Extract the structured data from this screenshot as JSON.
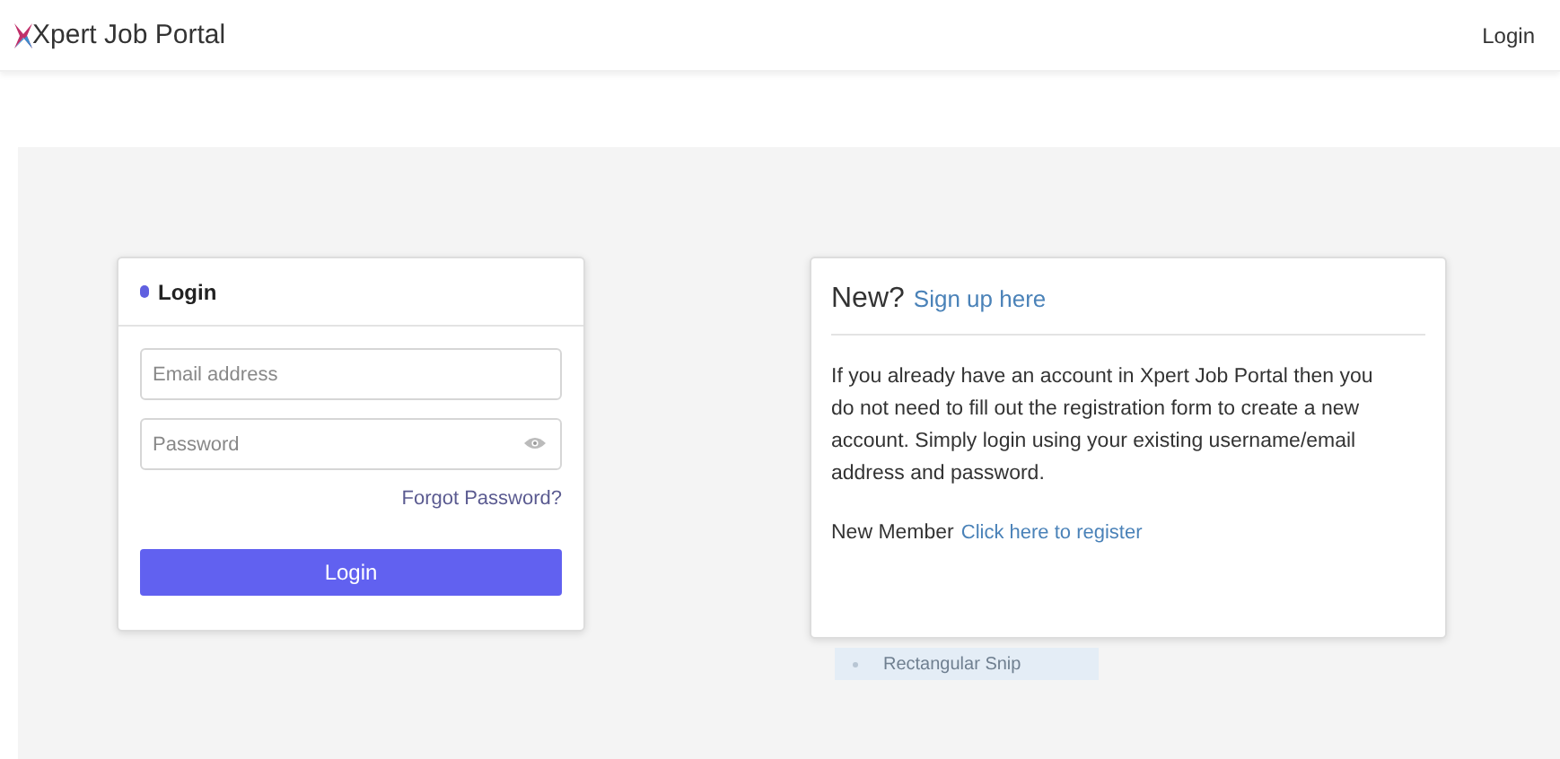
{
  "header": {
    "brand": "Xpert Job Portal",
    "nav_link": "Login"
  },
  "login_card": {
    "title": "Login",
    "email": {
      "placeholder": "Email address"
    },
    "password": {
      "placeholder": "Password"
    },
    "forgot_link": "Forgot Password?",
    "submit": "Login"
  },
  "signup_card": {
    "title": "New?",
    "title_link": "Sign up here",
    "text": "If you already have an account in Xpert Job Portal then you do not need to fill out the registration form to create a new account. Simply login using your existing username/email address and password.",
    "member_label": "New Member",
    "register_link": "Click here to register"
  },
  "snip_tooltip": {
    "label": "Rectangular Snip"
  }
}
